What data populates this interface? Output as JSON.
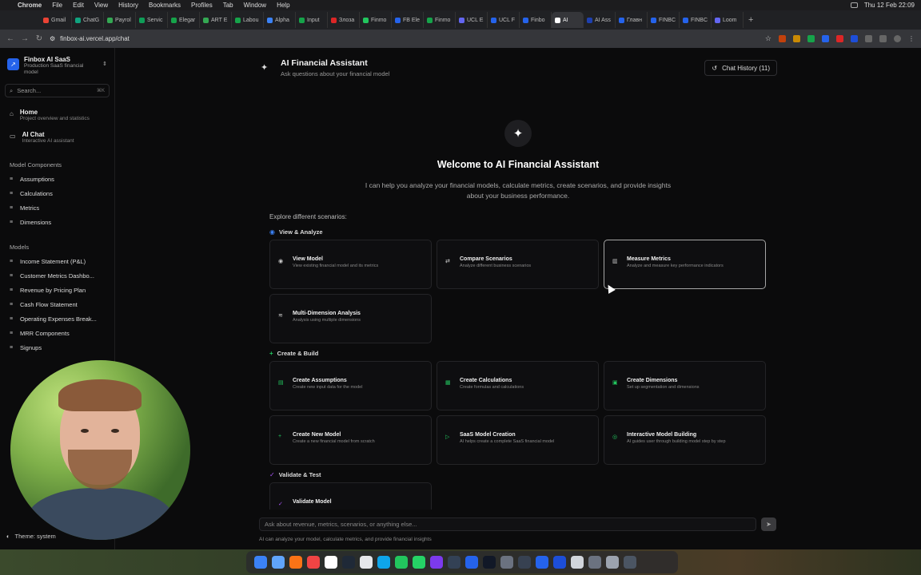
{
  "menubar": {
    "app": "Chrome",
    "items": [
      "File",
      "Edit",
      "View",
      "History",
      "Bookmarks",
      "Profiles",
      "Tab",
      "Window",
      "Help"
    ],
    "clock": "Thu 12 Feb  22:09"
  },
  "tabs": [
    "Gmail",
    "ChatG",
    "Payrol",
    "Servic",
    "Elegar",
    "ART E",
    "Labou",
    "Alpha",
    "Input",
    "Злоза",
    "Finmo",
    "FB Ele",
    "Finmo",
    "UCL E",
    "UCL F",
    "Finbo",
    "AI",
    "AI Ass",
    "Главн",
    "FINBC",
    "FINBC",
    "Loom"
  ],
  "address": {
    "url": "finbox-ai.vercel.app/chat"
  },
  "sidebar": {
    "org_name": "Finbox AI SaaS",
    "org_subtitle": "Production SaaS financial model",
    "search_placeholder": "Search...",
    "search_shortcut": "⌘K",
    "nav": [
      {
        "title": "Home",
        "desc": "Project overview and statistics"
      },
      {
        "title": "AI Chat",
        "desc": "Interactive AI assistant"
      }
    ],
    "model_components_title": "Model Components",
    "model_components": [
      "Assumptions",
      "Calculations",
      "Metrics",
      "Dimensions"
    ],
    "models_title": "Models",
    "models": [
      "Income Statement (P&L)",
      "Customer Metrics Dashbo...",
      "Revenue by Pricing Plan",
      "Cash Flow Statement",
      "Operating Expenses Break...",
      "MRR Components",
      "Signups"
    ],
    "theme": "Theme: system"
  },
  "header": {
    "title": "AI Financial Assistant",
    "subtitle": "Ask questions about your financial model",
    "history_button": "Chat History (11)"
  },
  "hero": {
    "title": "Welcome to AI Financial Assistant",
    "text": "I can help you analyze your financial models, calculate metrics, create scenarios, and provide insights about your business performance."
  },
  "explore_label": "Explore different scenarios:",
  "groups": [
    {
      "title": "View & Analyze",
      "color": "#3b82f6"
    },
    {
      "title": "Create & Build",
      "color": "#22c55e"
    },
    {
      "title": "Validate & Test",
      "color": "#a855f7"
    }
  ],
  "cards": [
    {
      "title": "View Model",
      "desc": "View existing financial model and its metrics",
      "icon": "eye-icon"
    },
    {
      "title": "Compare Scenarios",
      "desc": "Analyze different business scenarios",
      "icon": "compare-icon"
    },
    {
      "title": "Measure Metrics",
      "desc": "Analyze and measure key performance indicators",
      "icon": "chart-icon"
    },
    {
      "title": "Multi-Dimension Analysis",
      "desc": "Analysis using multiple dimensions",
      "icon": "layers-icon"
    },
    {
      "title": "Create Assumptions",
      "desc": "Create new input data for the model",
      "icon": "doc-icon"
    },
    {
      "title": "Create Calculations",
      "desc": "Create formulas and calculations",
      "icon": "calc-icon"
    },
    {
      "title": "Create Dimensions",
      "desc": "Set up segmentation and dimensions",
      "icon": "grid-icon"
    },
    {
      "title": "Create New Model",
      "desc": "Create a new financial model from scratch",
      "icon": "plus-icon"
    },
    {
      "title": "SaaS Model Creation",
      "desc": "AI helps create a complete SaaS financial model",
      "icon": "play-icon"
    },
    {
      "title": "Interactive Model Building",
      "desc": "AI guides user through building model step by step",
      "icon": "target-icon"
    },
    {
      "title": "Validate Model",
      "desc": "",
      "icon": "check-icon"
    }
  ],
  "composer": {
    "placeholder": "Ask about revenue, metrics, scenarios, or anything else...",
    "note": "AI can analyze your model, calculate metrics, and provide financial insights"
  }
}
